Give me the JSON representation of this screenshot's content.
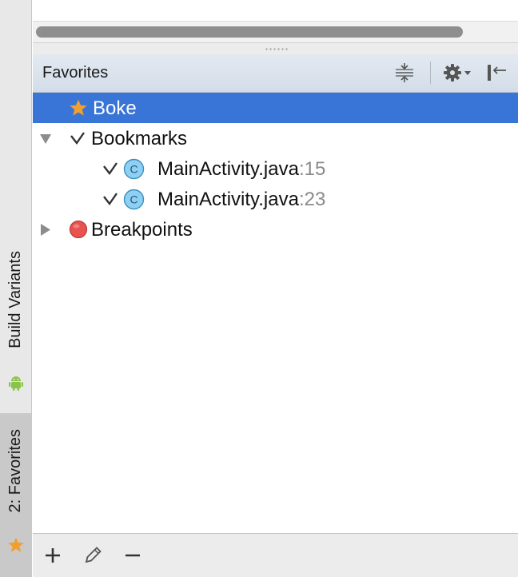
{
  "side_tabs": {
    "build_variants": "Build Variants",
    "favorites": "2: Favorites"
  },
  "panel": {
    "title": "Favorites",
    "toolbar_icons": [
      "collapse-all-icon",
      "gear-icon",
      "hide-panel-icon"
    ]
  },
  "tree": {
    "boke": "Boke",
    "bookmarks": "Bookmarks",
    "bookmark_items": [
      {
        "file": "MainActivity.java",
        "line": ":15"
      },
      {
        "file": "MainActivity.java",
        "line": ":23"
      }
    ],
    "breakpoints": "Breakpoints"
  },
  "bottom_toolbar": {
    "icons": [
      "add-icon",
      "edit-icon",
      "remove-icon"
    ]
  },
  "colors": {
    "selection": "#3875d7",
    "class_icon": "#8fd0f2",
    "breakpoint": "#e8534f",
    "star": "#f0a030"
  }
}
